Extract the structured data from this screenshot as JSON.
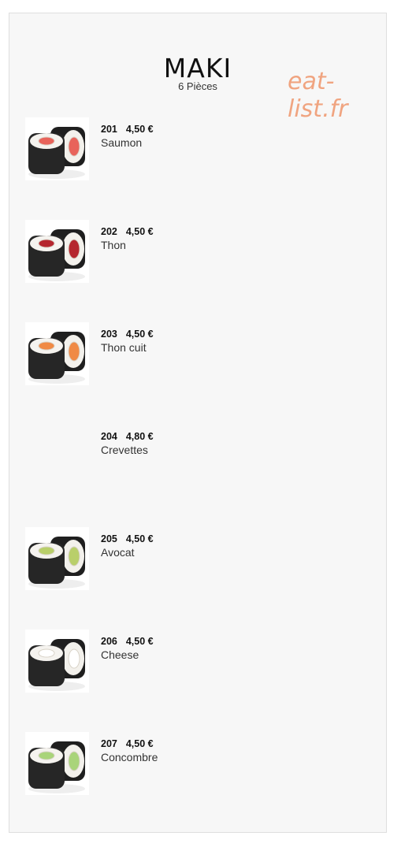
{
  "header": {
    "title": "MAKI",
    "subtitle": "6 Pièces",
    "watermark": "eat-list.fr"
  },
  "items": [
    {
      "number": "201",
      "price": "4,50 €",
      "name": "Saumon",
      "has_image": true,
      "filling": "#e8635a"
    },
    {
      "number": "202",
      "price": "4,50 €",
      "name": "Thon",
      "has_image": true,
      "filling": "#b5262e"
    },
    {
      "number": "203",
      "price": "4,50 €",
      "name": "Thon cuit",
      "has_image": true,
      "filling": "#f08a45"
    },
    {
      "number": "204",
      "price": "4,80 €",
      "name": "Crevettes",
      "has_image": false,
      "filling": ""
    },
    {
      "number": "205",
      "price": "4,50 €",
      "name": "Avocat",
      "has_image": true,
      "filling": "#b9cf6a"
    },
    {
      "number": "206",
      "price": "4,50 €",
      "name": "Cheese",
      "has_image": true,
      "filling": "#ffffff"
    },
    {
      "number": "207",
      "price": "4,50 €",
      "name": "Concombre",
      "has_image": true,
      "filling": "#a9d47a"
    }
  ]
}
